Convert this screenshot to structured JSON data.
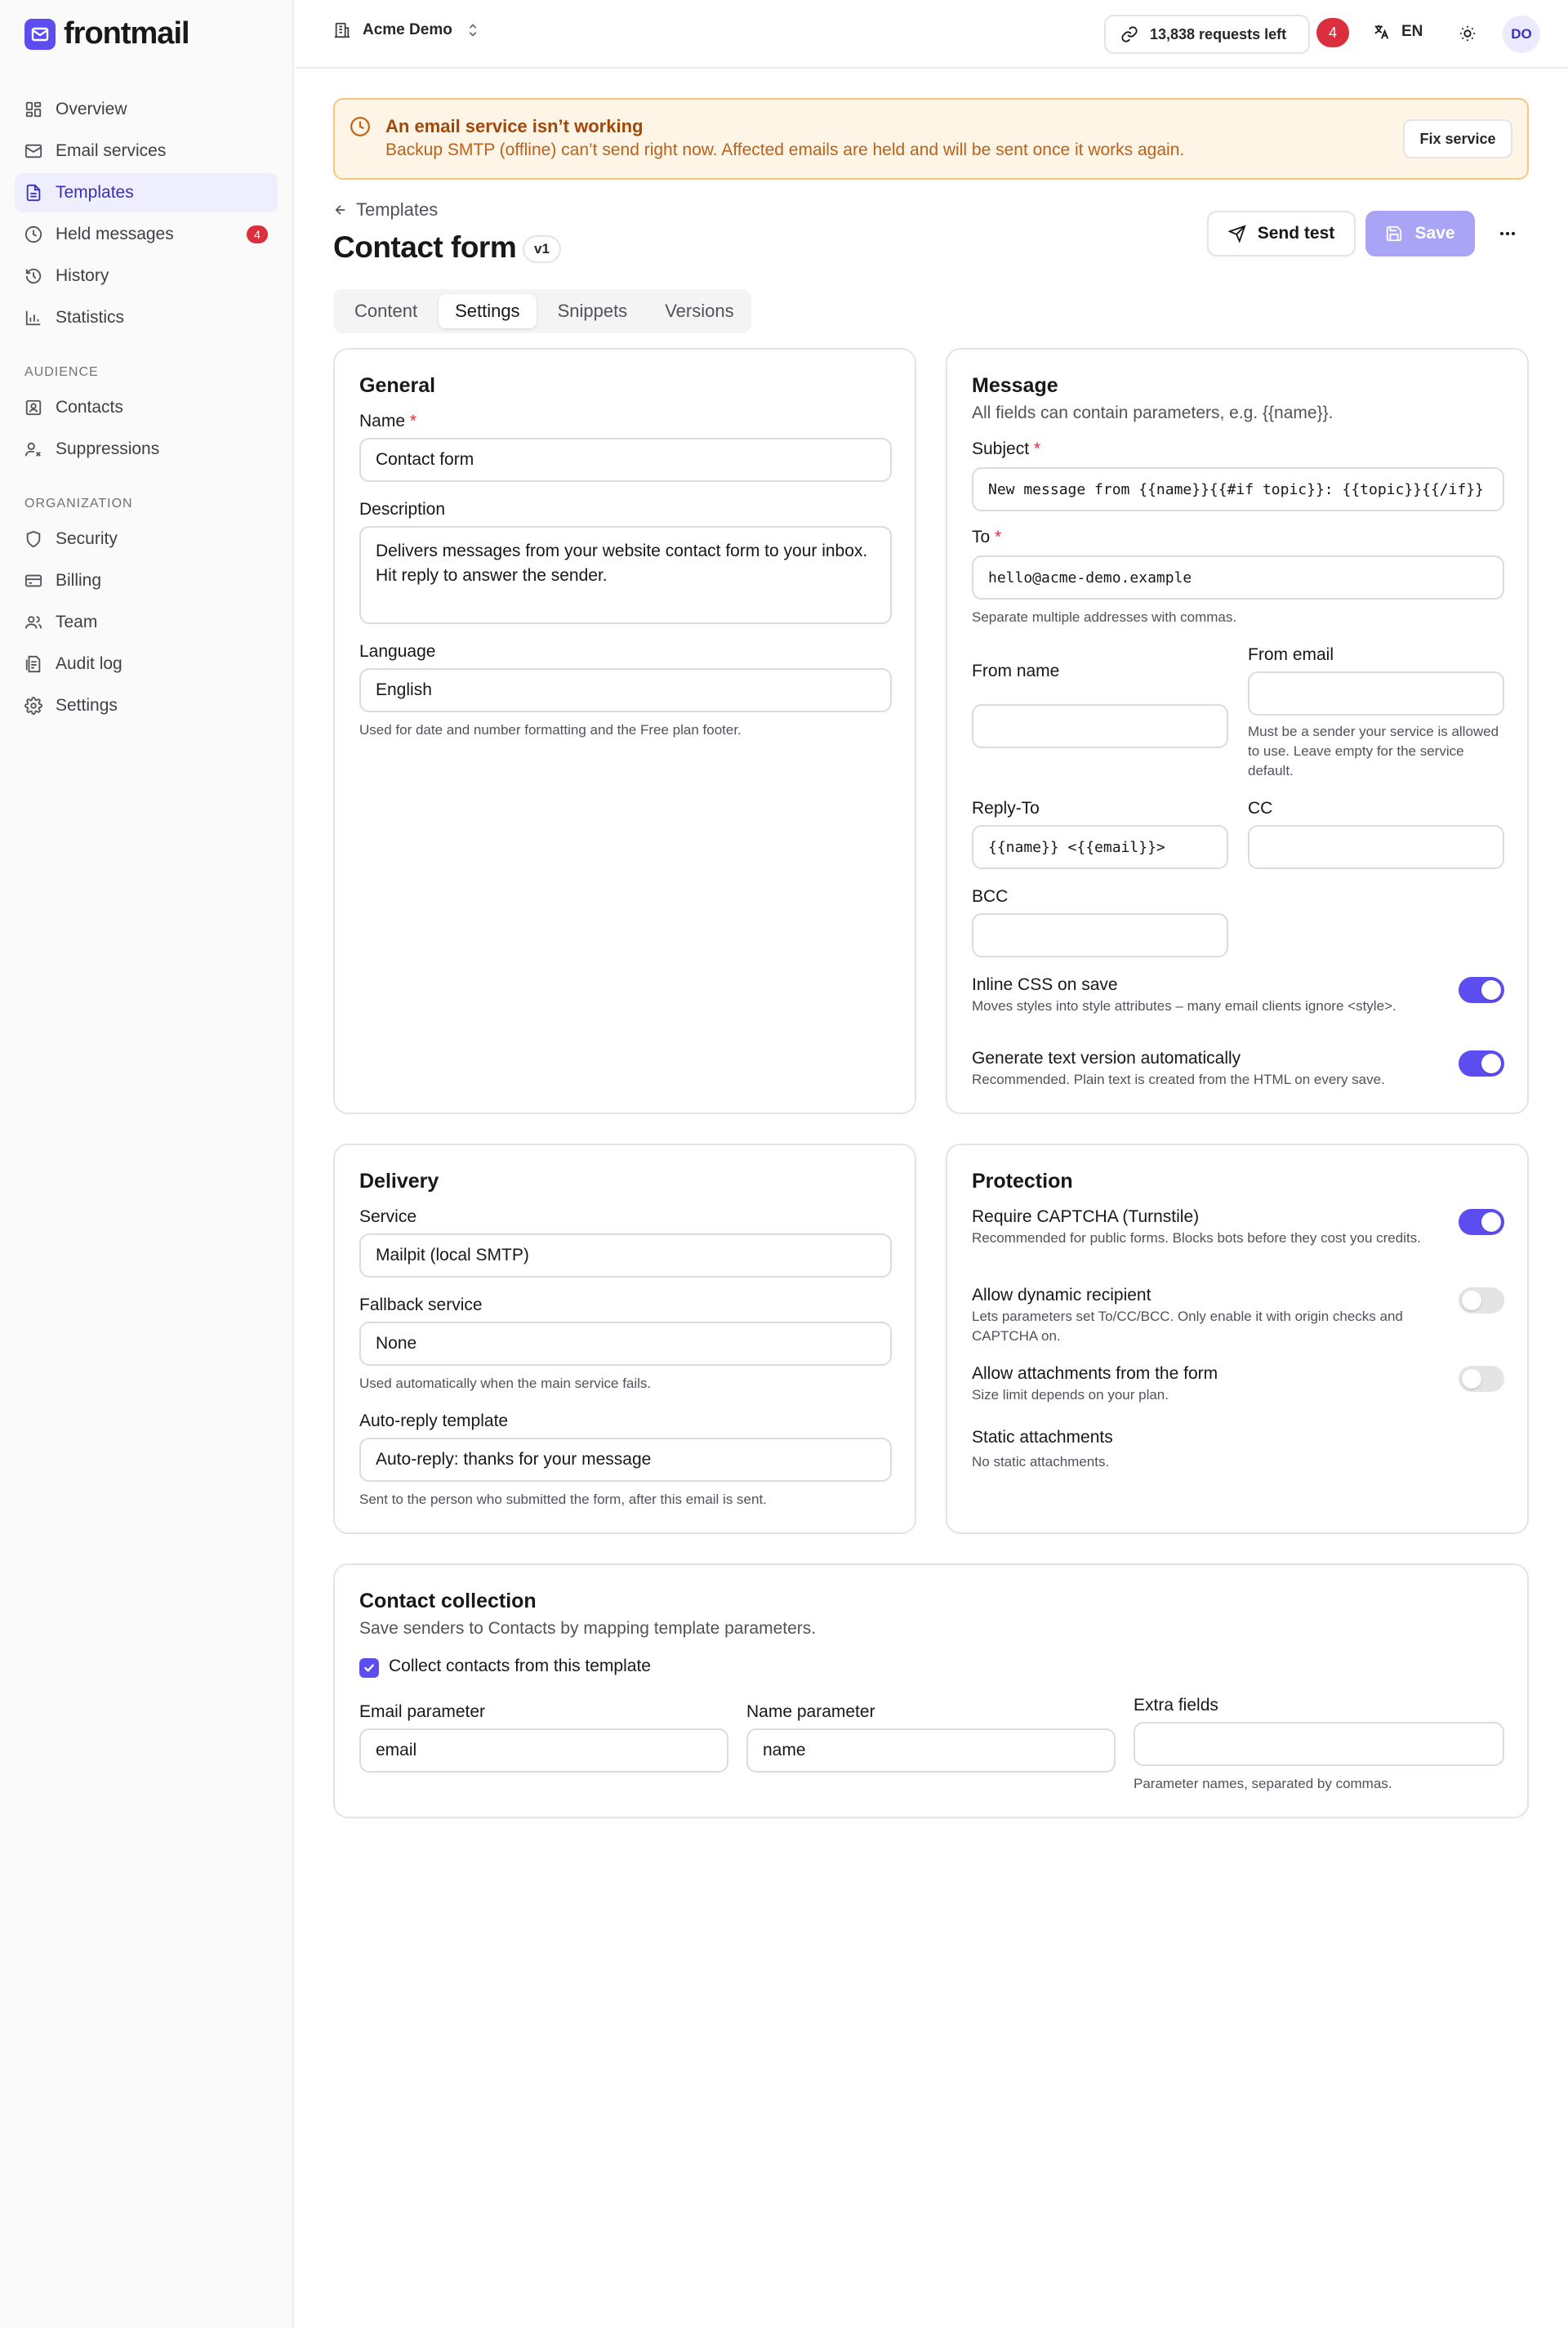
{
  "brand": {
    "name": "frontmail",
    "accent": "#5b4df0"
  },
  "sidebar": {
    "items": [
      {
        "label": "Overview",
        "icon": "dashboard-icon"
      },
      {
        "label": "Email services",
        "icon": "mail-icon"
      },
      {
        "label": "Templates",
        "icon": "document-icon",
        "active": true
      },
      {
        "label": "Held messages",
        "icon": "clock-icon",
        "badge": "4"
      },
      {
        "label": "History",
        "icon": "history-icon"
      },
      {
        "label": "Statistics",
        "icon": "chart-icon"
      }
    ],
    "audience_heading": "AUDIENCE",
    "audience": [
      {
        "label": "Contacts",
        "icon": "contact-icon"
      },
      {
        "label": "Suppressions",
        "icon": "user-block-icon"
      }
    ],
    "organization_heading": "ORGANIZATION",
    "organization": [
      {
        "label": "Security",
        "icon": "shield-icon"
      },
      {
        "label": "Billing",
        "icon": "credit-card-icon"
      },
      {
        "label": "Team",
        "icon": "team-icon"
      },
      {
        "label": "Audit log",
        "icon": "log-icon"
      },
      {
        "label": "Settings",
        "icon": "gear-icon"
      }
    ]
  },
  "topbar": {
    "workspace": "Acme Demo",
    "requests": "13,838 requests left",
    "notifications": "4",
    "language": "EN",
    "avatar": "DO"
  },
  "alert": {
    "title": "An email service isn’t working",
    "text": "Backup SMTP (offline) can’t send right now. Affected emails are held and will be sent once it works again.",
    "button": "Fix service"
  },
  "header": {
    "back": "Templates",
    "title": "Contact form",
    "version": "v1",
    "send_test": "Send test",
    "save": "Save"
  },
  "tabs": [
    "Content",
    "Settings",
    "Snippets",
    "Versions"
  ],
  "general": {
    "title": "General",
    "name_label": "Name",
    "name_value": "Contact form",
    "description_label": "Description",
    "description_value": "Delivers messages from your website contact form to your inbox. Hit reply to answer the sender.",
    "language_label": "Language",
    "language_value": "English",
    "language_help": "Used for date and number formatting and the Free plan footer."
  },
  "message": {
    "title": "Message",
    "subtitle": "All fields can contain parameters, e.g. {{name}}.",
    "subject_label": "Subject",
    "subject_value": "New message from {{name}}{{#if topic}}: {{topic}}{{/if}}",
    "to_label": "To",
    "to_value": "hello@acme-demo.example",
    "to_help": "Separate multiple addresses with commas.",
    "from_name_label": "From name",
    "from_name_value": "",
    "from_email_label": "From email",
    "from_email_value": "",
    "from_email_help": "Must be a sender your service is allowed to use. Leave empty for the service default.",
    "reply_to_label": "Reply-To",
    "reply_to_value": "{{name}} <{{email}}>",
    "cc_label": "CC",
    "cc_value": "",
    "bcc_label": "BCC",
    "bcc_value": "",
    "inline_css_title": "Inline CSS on save",
    "inline_css_desc": "Moves styles into style attributes – many email clients ignore <style>.",
    "inline_css_on": true,
    "text_version_title": "Generate text version automatically",
    "text_version_desc": "Recommended. Plain text is created from the HTML on every save.",
    "text_version_on": true
  },
  "delivery": {
    "title": "Delivery",
    "service_label": "Service",
    "service_value": "Mailpit (local SMTP)",
    "fallback_label": "Fallback service",
    "fallback_value": "None",
    "fallback_help": "Used automatically when the main service fails.",
    "autoreply_label": "Auto-reply template",
    "autoreply_value": "Auto-reply: thanks for your message",
    "autoreply_help": "Sent to the person who submitted the form, after this email is sent."
  },
  "protection": {
    "title": "Protection",
    "captcha_title": "Require CAPTCHA (Turnstile)",
    "captcha_desc": "Recommended for public forms. Blocks bots before they cost you credits.",
    "captcha_on": true,
    "dynamic_title": "Allow dynamic recipient",
    "dynamic_desc": "Lets parameters set To/CC/BCC. Only enable it with origin checks and CAPTCHA on.",
    "dynamic_on": false,
    "attachments_title": "Allow attachments from the form",
    "attachments_desc": "Size limit depends on your plan.",
    "attachments_on": false,
    "static_title": "Static attachments",
    "static_desc": "No static attachments."
  },
  "contact_collection": {
    "title": "Contact collection",
    "subtitle": "Save senders to Contacts by mapping template parameters.",
    "checkbox_label": "Collect contacts from this template",
    "checked": true,
    "email_param_label": "Email parameter",
    "email_param_value": "email",
    "name_param_label": "Name parameter",
    "name_param_value": "name",
    "extra_label": "Extra fields",
    "extra_value": "",
    "extra_help": "Parameter names, separated by commas."
  }
}
